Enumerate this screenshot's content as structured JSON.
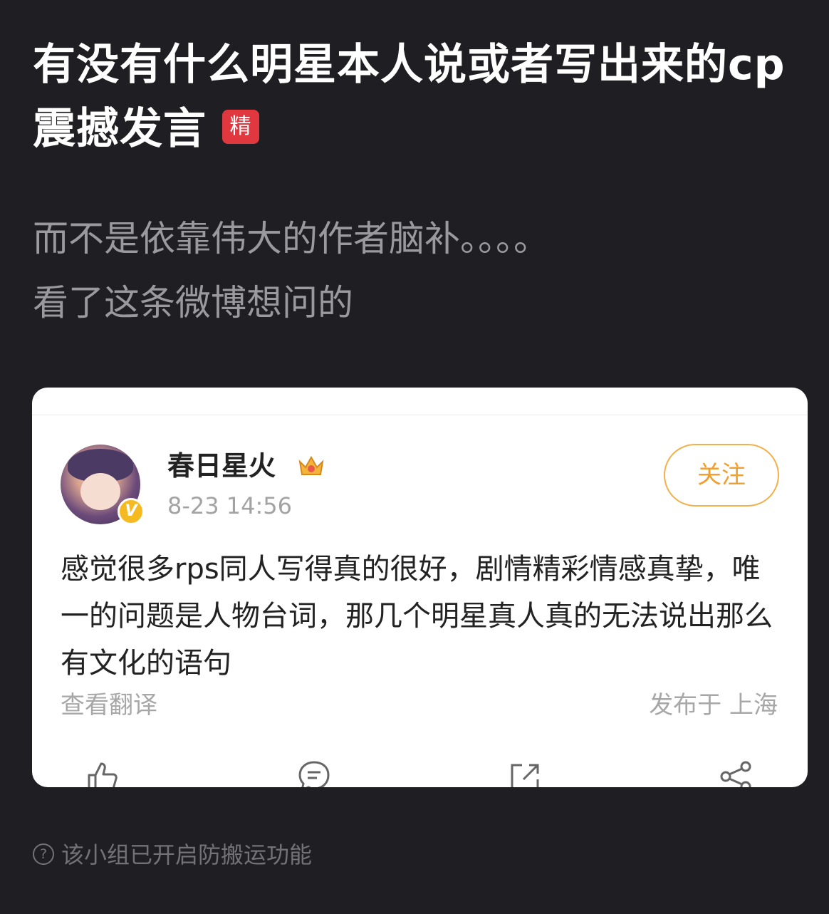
{
  "post": {
    "title": "有没有什么明星本人说或者写出来的cp震撼发言",
    "badge": "精",
    "body_lines": [
      "而不是依靠伟大的作者脑补。。。。",
      "看了这条微博想问的"
    ]
  },
  "embedded_weibo": {
    "username": "春日星火",
    "verified_badge": "V",
    "timestamp": "8-23 14:56",
    "follow_label": "关注",
    "content": "感觉很多rps同人写得真的很好，剧情精彩情感真挚，唯一的问题是人物台词，那几个明星真人真的无法说出那么有文化的语句",
    "translate_label": "查看翻译",
    "location_label": "发布于 上海",
    "actions": [
      "like-icon",
      "comment-icon",
      "repost-icon",
      "share-icon"
    ],
    "colors": {
      "follow": "#f0a030",
      "verified": "#f5b921"
    }
  },
  "footer": {
    "notice": "该小组已开启防搬运功能",
    "help_glyph": "?"
  },
  "colors": {
    "background": "#1f1e23",
    "badge": "#e0383e"
  }
}
